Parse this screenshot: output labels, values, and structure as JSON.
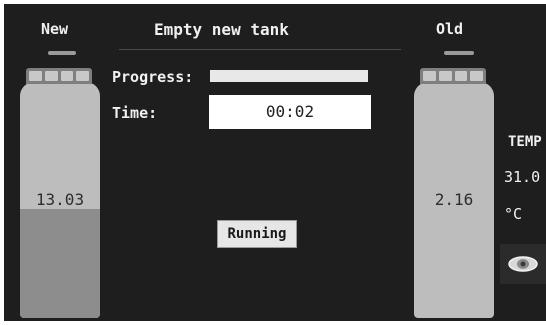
{
  "header": {
    "title": "Empty new tank",
    "new_label": "New",
    "old_label": "Old"
  },
  "tanks": {
    "new": {
      "value": "13.03",
      "fill_fraction": 0.46
    },
    "old": {
      "value": "2.16",
      "fill_fraction": 0.0
    }
  },
  "progress": {
    "label": "Progress:",
    "fraction": 0.0
  },
  "time": {
    "label": "Time:",
    "value": "00:02"
  },
  "run_button": {
    "label": "Running"
  },
  "temperature": {
    "label": "TEMP",
    "value": "31.0",
    "unit": "°C"
  },
  "icons": {
    "eye": "eye-icon"
  },
  "colors": {
    "background": "#1e1e1e",
    "tank_body": "#bdbdbd",
    "tank_fill": "#8d8d8d",
    "text": "#f0f0f0"
  }
}
